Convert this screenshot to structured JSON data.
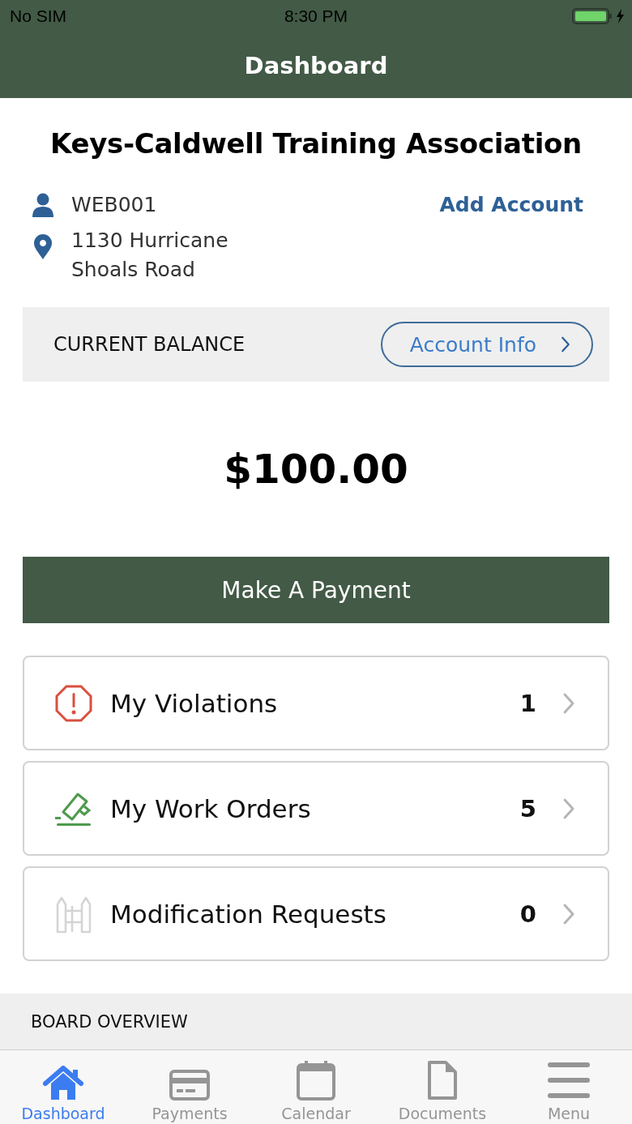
{
  "status_bar": {
    "carrier": "No SIM",
    "time": "8:30 PM",
    "charging": true
  },
  "nav_bar": {
    "title": "Dashboard"
  },
  "association": {
    "name": "Keys-Caldwell Training Association"
  },
  "account": {
    "id": "WEB001",
    "address": "1130 Hurricane\nShoals Road",
    "add_account": "Add Account"
  },
  "balance": {
    "label": "CURRENT BALANCE",
    "account_info": "Account Info",
    "amount": "$100.00",
    "pay_button": "Make A Payment"
  },
  "cards": [
    {
      "kind": "violations",
      "label": "My Violations",
      "count": "1"
    },
    {
      "kind": "work_orders",
      "label": "My Work Orders",
      "count": "5"
    },
    {
      "kind": "modifications",
      "label": "Modification Requests",
      "count": "0"
    }
  ],
  "board_overview": {
    "label": "BOARD OVERVIEW"
  },
  "tabs": [
    {
      "kind": "home",
      "label": "Dashboard",
      "selected": true
    },
    {
      "kind": "card",
      "label": "Payments",
      "selected": false
    },
    {
      "kind": "calendar",
      "label": "Calendar",
      "selected": false
    },
    {
      "kind": "document",
      "label": "Documents",
      "selected": false
    },
    {
      "kind": "menu",
      "label": "Menu",
      "selected": false
    }
  ]
}
